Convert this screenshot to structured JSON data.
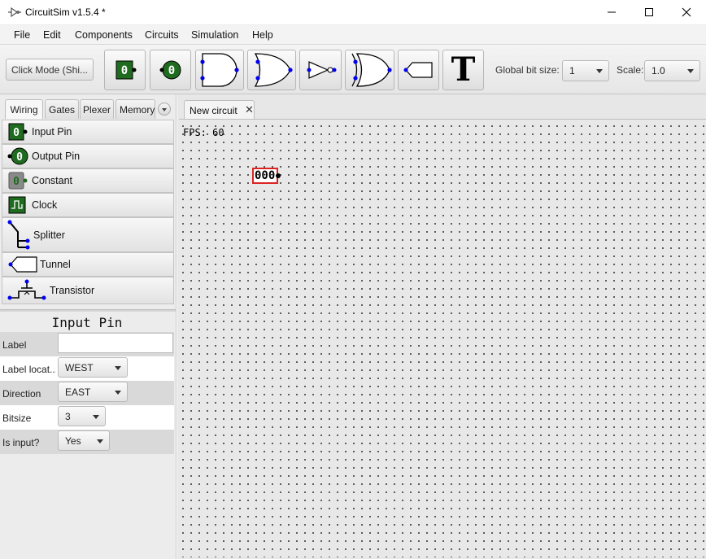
{
  "window": {
    "title": "CircuitSim v1.5.4 *"
  },
  "menubar": {
    "items": [
      "File",
      "Edit",
      "Components",
      "Circuits",
      "Simulation",
      "Help"
    ]
  },
  "toolbar": {
    "click_mode_label": "Click Mode (Shi...",
    "tools": [
      "input-pin",
      "output-pin",
      "and-gate",
      "or-gate",
      "not-gate",
      "xor-gate",
      "tunnel",
      "text"
    ],
    "input_pin_value": "0",
    "output_pin_value": "0",
    "text_tool_glyph": "T",
    "global_bit_size_label": "Global bit size:",
    "global_bit_size_value": "1",
    "scale_label": "Scale:",
    "scale_value": "1.0"
  },
  "palette": {
    "tabs": [
      "Wiring",
      "Gates",
      "Plexer",
      "Memory"
    ],
    "active_tab": "Wiring",
    "items": [
      {
        "label": "Input Pin",
        "icon": "input-pin-icon"
      },
      {
        "label": "Output Pin",
        "icon": "output-pin-icon"
      },
      {
        "label": "Constant",
        "icon": "constant-icon"
      },
      {
        "label": "Clock",
        "icon": "clock-icon"
      },
      {
        "label": "Splitter",
        "icon": "splitter-icon"
      },
      {
        "label": "Tunnel",
        "icon": "tunnel-icon"
      },
      {
        "label": "Transistor",
        "icon": "transistor-icon"
      }
    ],
    "icon_values": {
      "input_pin": "0",
      "output_pin": "0",
      "constant": "0"
    }
  },
  "properties": {
    "title": "Input Pin",
    "rows": [
      {
        "label": "Label",
        "value": ""
      },
      {
        "label": "Label locat...",
        "value": "WEST"
      },
      {
        "label": "Direction",
        "value": "EAST"
      },
      {
        "label": "Bitsize",
        "value": "3"
      },
      {
        "label": "Is input?",
        "value": "Yes"
      }
    ]
  },
  "canvas": {
    "tab_label": "New circuit",
    "tab_close": "✕",
    "fps_text": "FPS: 60",
    "pin_value": "000"
  },
  "colors": {
    "pin_green": "#1f6b1f",
    "port_blue": "#0000ee",
    "selection_red": "#dd2222"
  }
}
